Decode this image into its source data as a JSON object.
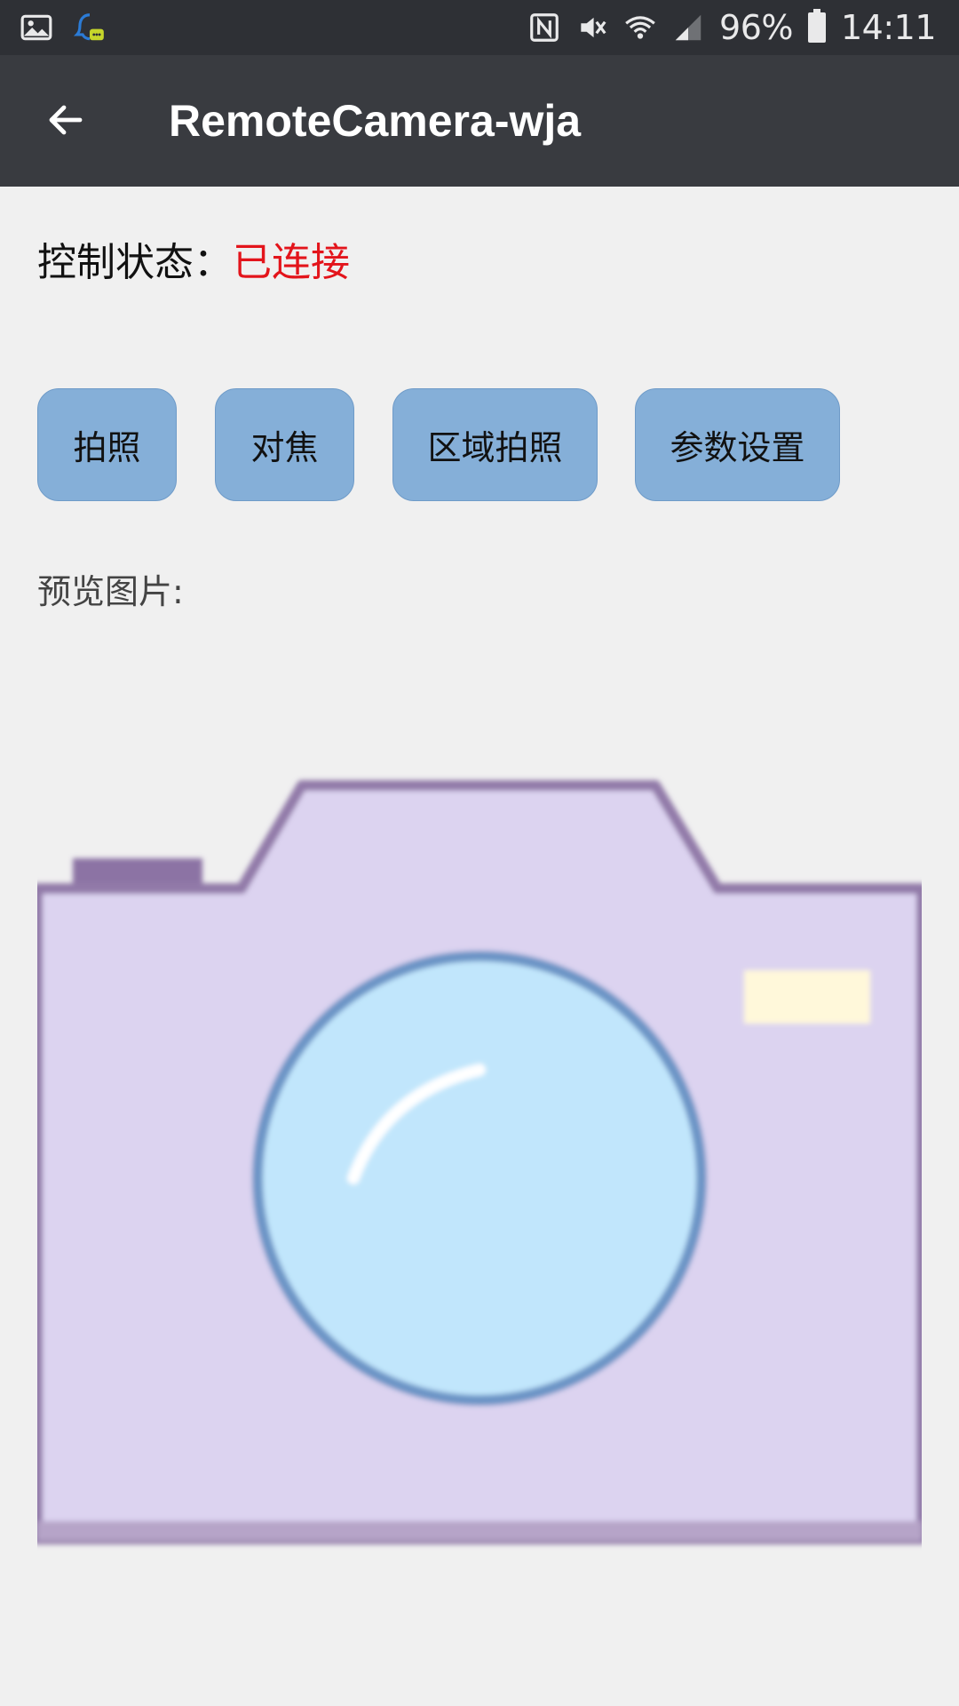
{
  "status_bar": {
    "notification_icons": [
      "image-icon",
      "qq-chat-icon"
    ],
    "system_icons": [
      "nfc-icon",
      "mute-icon",
      "wifi-icon",
      "signal-icon"
    ],
    "battery": "96%",
    "time": "14:11"
  },
  "app_bar": {
    "back_icon": "arrow-left-icon",
    "title": "RemoteCamera-wja"
  },
  "control_status": {
    "label": "控制状态：",
    "value": "已连接",
    "value_color": "#e3141b"
  },
  "actions": [
    {
      "label": "拍照"
    },
    {
      "label": "对焦"
    },
    {
      "label": "区域拍照"
    },
    {
      "label": "参数设置"
    }
  ],
  "preview": {
    "label": "预览图片:",
    "image_icon": "camera-placeholder-icon"
  },
  "colors": {
    "status_bar_bg": "#2e3035",
    "app_bar_bg": "#393b40",
    "page_bg": "#f0f0f0",
    "button_bg": "#85afd8",
    "camera_body": "#dcd3f0",
    "camera_lens": "#c1e6fc",
    "camera_outline": "#927aa9"
  }
}
